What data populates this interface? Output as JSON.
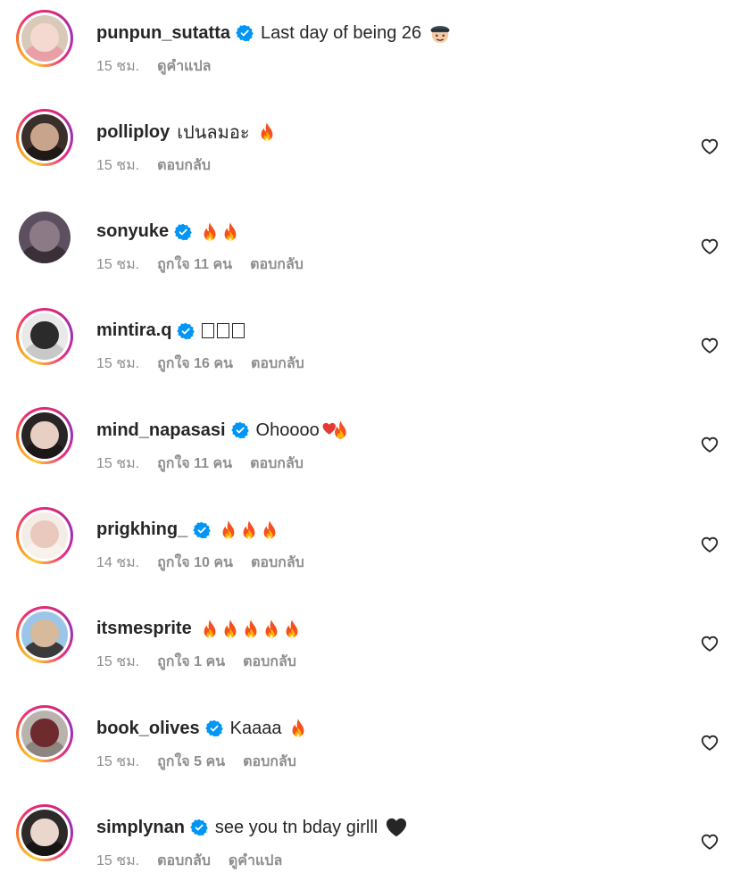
{
  "comments": [
    {
      "username": "punpun_sutatta",
      "verified": true,
      "text": "Last day of being 26",
      "emojis": [
        "man-emoji"
      ],
      "time": "15 ชม.",
      "likes": "",
      "actions": [
        "ดูคำแปล"
      ],
      "heart": false,
      "ring": true,
      "palette": [
        "#d9c9b8",
        "#f3d9cf",
        "#e8a0a6"
      ]
    },
    {
      "username": "polliploy",
      "verified": false,
      "text": "เปนลมอะ",
      "emojis": [
        "fire"
      ],
      "time": "15 ชม.",
      "likes": "",
      "actions": [
        "ตอบกลับ"
      ],
      "heart": true,
      "ring": true,
      "palette": [
        "#3a2f2a",
        "#c9a48c",
        "#1f1a17"
      ]
    },
    {
      "username": "sonyuke",
      "verified": true,
      "text": "",
      "emojis": [
        "fire",
        "fire"
      ],
      "time": "15 ชม.",
      "likes": "ถูกใจ 11 คน",
      "actions": [
        "ตอบกลับ"
      ],
      "heart": true,
      "ring": false,
      "palette": [
        "#5c5060",
        "#8c7a86",
        "#3c3038"
      ]
    },
    {
      "username": "mintira.q",
      "verified": true,
      "text": "",
      "emojis": [
        "boxes"
      ],
      "time": "15 ชม.",
      "likes": "ถูกใจ 16 คน",
      "actions": [
        "ตอบกลับ"
      ],
      "heart": true,
      "ring": true,
      "palette": [
        "#e9e9e9",
        "#2b2b2b",
        "#c8c8c8"
      ]
    },
    {
      "username": "mind_napasasi",
      "verified": true,
      "text": "Ohoooo",
      "emojis": [
        "heart-fire"
      ],
      "time": "15 ชม.",
      "likes": "ถูกใจ 11 คน",
      "actions": [
        "ตอบกลับ"
      ],
      "heart": true,
      "ring": true,
      "palette": [
        "#2a2525",
        "#e7cfc4",
        "#1c1818"
      ]
    },
    {
      "username": "prigkhing_",
      "verified": true,
      "text": "",
      "emojis": [
        "fire",
        "fire",
        "fire"
      ],
      "time": "14 ชม.",
      "likes": "ถูกใจ 10 คน",
      "actions": [
        "ตอบกลับ"
      ],
      "heart": true,
      "ring": true,
      "palette": [
        "#f4ece6",
        "#e9c9bd",
        "#f8f1ec"
      ]
    },
    {
      "username": "itsmesprite",
      "verified": false,
      "text": "",
      "emojis": [
        "fire",
        "fire",
        "fire",
        "fire",
        "fire"
      ],
      "time": "15 ชม.",
      "likes": "ถูกใจ 1 คน",
      "actions": [
        "ตอบกลับ"
      ],
      "heart": true,
      "ring": true,
      "palette": [
        "#9cc6e8",
        "#d7b99c",
        "#3a3a3a"
      ]
    },
    {
      "username": "book_olives",
      "verified": true,
      "text": "Kaaaa",
      "emojis": [
        "fire"
      ],
      "time": "15 ชม.",
      "likes": "ถูกใจ 5 คน",
      "actions": [
        "ตอบกลับ"
      ],
      "heart": true,
      "ring": true,
      "palette": [
        "#b9b3ad",
        "#6f2a2f",
        "#8d8680"
      ]
    },
    {
      "username": "simplynan",
      "verified": true,
      "text": "see you tn bday girlll",
      "emojis": [
        "black-heart"
      ],
      "time": "15 ชม.",
      "likes": "",
      "actions": [
        "ตอบกลับ",
        "ดูคำแปล"
      ],
      "heart": true,
      "ring": true,
      "palette": [
        "#2e2a2a",
        "#e9d6cc",
        "#171414"
      ]
    }
  ],
  "colors": {
    "verified": "#0095f6",
    "muted": "#8e8e8e",
    "text": "#262626"
  }
}
